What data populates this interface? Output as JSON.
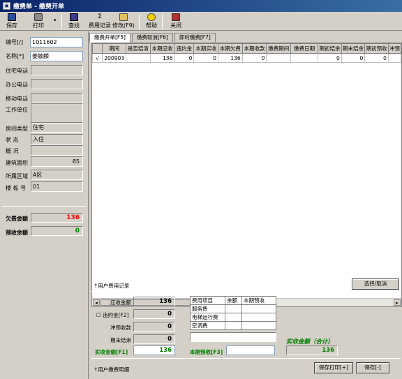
{
  "window": {
    "title": "缴费单 - 缴费开单"
  },
  "toolbar": {
    "save": "保存",
    "print": "打印",
    "search": "查找",
    "fee_record": "费用记录",
    "modify": "修改(F9)",
    "help": "帮助",
    "close": "关闭"
  },
  "left": {
    "id_label": "编号[/]",
    "id_value": "1011602",
    "name_label": "名称[*]",
    "name_value": "姜敏麟",
    "home_phone": "住宅电话",
    "office_phone": "办公电话",
    "mobile_phone": "移动电话",
    "work_unit": "工作单位",
    "room_type_label": "房间类型",
    "room_type_value": "住宅",
    "status_label": "状 态",
    "status_value": "入住",
    "condition_label": "概 况",
    "area_label": "建筑面积",
    "area_value": "85",
    "region_label": "所属区域",
    "region_value": "A区",
    "building_label": "楼 栋 号",
    "building_value": "01",
    "owed_label": "欠费金额",
    "owed_value": "136",
    "prepaid_label": "预收余额",
    "prepaid_value": "0"
  },
  "tabs": [
    "缴费开单[F5]",
    "缴费取消[F6]",
    "即时缴费[F7]"
  ],
  "grid": {
    "headers": [
      "",
      "期间",
      "是否结清",
      "本期应收",
      "违约金",
      "本期实收",
      "本期欠费",
      "本期收款",
      "缴费期间",
      "缴费日期",
      "期初结余",
      "期末结余",
      "期初预收",
      "冲预"
    ],
    "rows": [
      [
        "√",
        "200903",
        "",
        "136",
        "0",
        "0",
        "136",
        "0",
        "",
        "",
        "0",
        "0",
        "0",
        ""
      ]
    ]
  },
  "record_bar": {
    "label": "↑用户费用记录",
    "select_btn": "选择/取消"
  },
  "bottom": {
    "receivable_label": "应收金额",
    "receivable_value": "136",
    "penalty_label": "违约金[F2]",
    "penalty_value": "0",
    "offset_label": "冲预收款",
    "offset_value": "0",
    "period_end_label": "期末结余",
    "period_end_value": "0",
    "actual_label": "实收金额[F1]",
    "actual_value": "136",
    "prepay_label": "本期预收[F3]",
    "prepay_value": "",
    "items_headers": [
      "费用项目",
      "余额",
      "本期预收"
    ],
    "items": [
      [
        "服务费",
        "",
        ""
      ],
      [
        "电梯运行费",
        "",
        ""
      ],
      [
        "空调费",
        "",
        ""
      ]
    ],
    "total_label": "实收金额（合计）",
    "total_value": "136",
    "detail_label": "↑用户缴费明细",
    "save_print": "保存打印[+]",
    "save": "保存[-]"
  }
}
